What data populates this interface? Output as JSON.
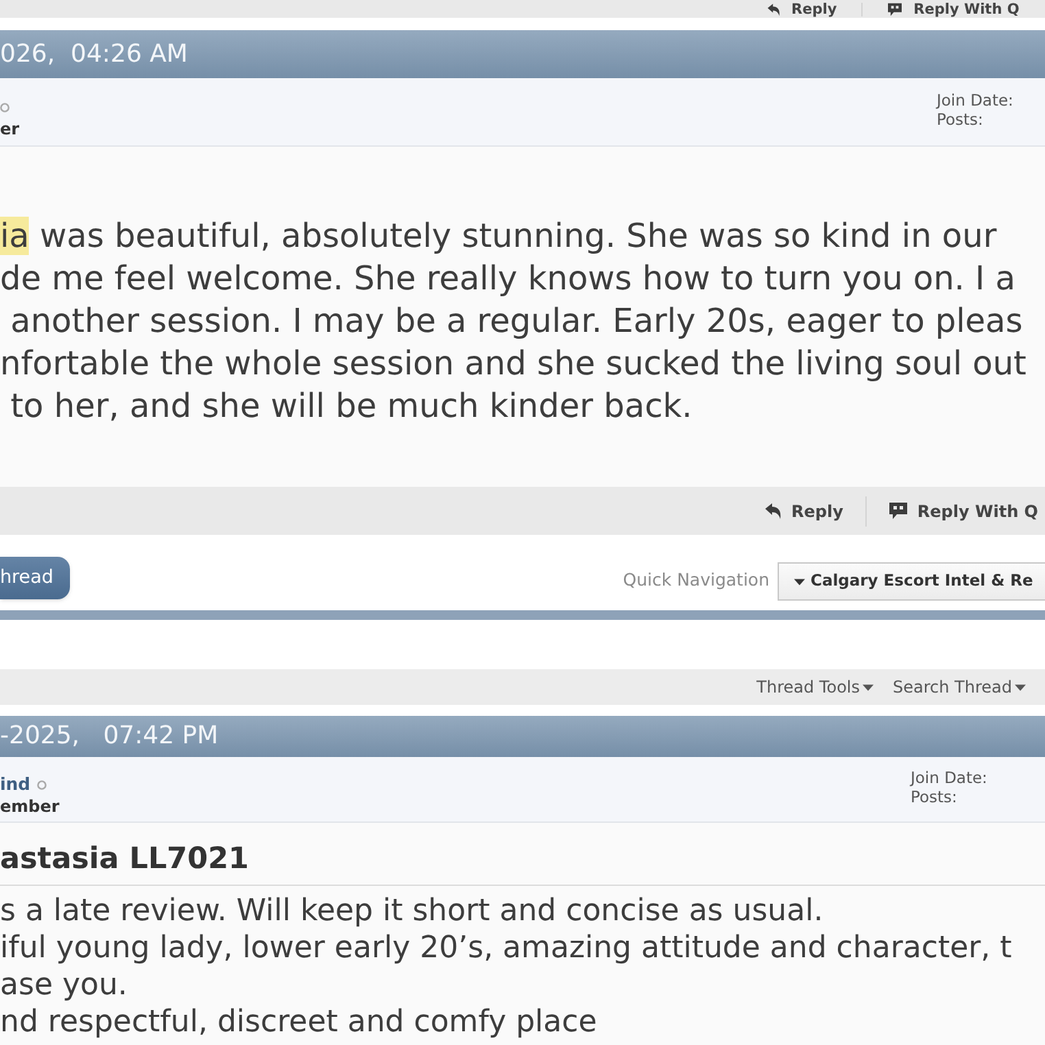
{
  "top_toolbar": {
    "buttons": [
      {
        "kind": "reply",
        "label": "Reply"
      },
      {
        "kind": "quote",
        "label": "Reply With Q"
      }
    ]
  },
  "upper_post": {
    "date": "026,  04:26 AM",
    "user": {
      "online": false,
      "title": "er"
    },
    "info_labels": [
      "Join Date:",
      "Posts:"
    ],
    "body": {
      "highlight": "ia",
      "text": " was beautiful, absolutely stunning. She was so kind in our\nde me feel welcome. She really knows how to turn you on. I a\n another session. I may be a regular. Early 20s, eager to pleas\nnfortable the whole session and she sucked the living soul out\n to her, and she will be much kinder back."
    },
    "footer_buttons": [
      {
        "kind": "reply",
        "label": "Reply"
      },
      {
        "kind": "quote",
        "label": "Reply With Q"
      }
    ]
  },
  "thread_nav": {
    "button": "hread",
    "quick_nav_label": "Quick Navigation",
    "quick_nav_value": "Calgary Escort Intel & Re"
  },
  "thread_toolbar": {
    "menus": [
      "Thread Tools",
      "Search Thread"
    ]
  },
  "lower_post": {
    "date": "-2025,   07:42 PM",
    "user": {
      "name": "ind",
      "online": false,
      "title": "ember"
    },
    "info_labels": [
      "Join Date:",
      "Posts:"
    ],
    "title": "astasia LL7021",
    "body": "s a late review. Will keep it short and concise as usual.\niful young lady, lower early 20’s, amazing attitude and character, t\nase you.\nnd respectful, discreet and comfy place"
  }
}
